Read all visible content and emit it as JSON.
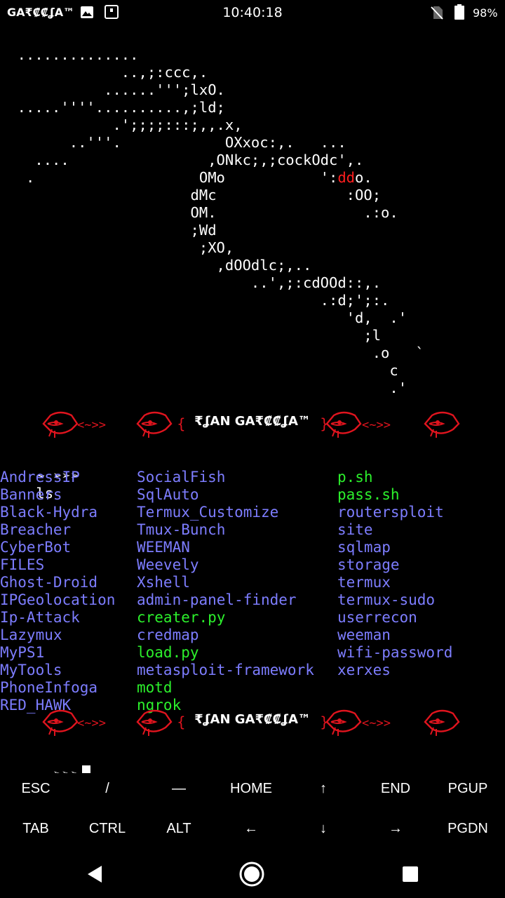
{
  "status_bar": {
    "carrier": "GA₹₡₡ʆA™",
    "time": "10:40:18",
    "battery": "98%",
    "icons": [
      "image-icon",
      "screenshot-icon",
      "no-sim-icon",
      "battery-icon"
    ]
  },
  "ascii_art": {
    "lines": [
      "  ..............",
      "              ..,;:ccc,.",
      "            ......''';lxO.",
      "  .....''''..........,;ld;",
      "             .';;;;:::;,,.x,",
      "        ..'''.            OXxoc:,.   ...",
      "    ....                ,ONkc;,;cockOdc',.",
      "   .                   OMo           ':",
      "                      dMc               :OO;",
      "                      OM.                 .:o.",
      "                      ;Wd",
      "                       ;XO,",
      "                         ,dOOdlc;,..",
      "                             ..',;:cdOOd::,.",
      "                                     .:d;';:.",
      "                                        'd,  .'",
      "                                          ;l",
      "                                           .o   `",
      "                                             c",
      "                                             .'"
    ],
    "line8_red": "dd",
    "line8_tail": "o."
  },
  "banner": {
    "text": "₹ʆAN GA₹₡₡ʆA™",
    "arrows": "<~>>",
    "fish_color": "#e0141e"
  },
  "prompt": {
    "symbol": "~ ➢➢➢",
    "command": "ls"
  },
  "listing": {
    "col1": [
      {
        "name": "AndressIP",
        "type": "dir"
      },
      {
        "name": "Banners",
        "type": "dir"
      },
      {
        "name": "Black-Hydra",
        "type": "dir"
      },
      {
        "name": "Breacher",
        "type": "dir"
      },
      {
        "name": "CyberBot",
        "type": "dir"
      },
      {
        "name": "FILES",
        "type": "dir"
      },
      {
        "name": "Ghost-Droid",
        "type": "dir"
      },
      {
        "name": "IPGeolocation",
        "type": "dir"
      },
      {
        "name": "Ip-Attack",
        "type": "dir"
      },
      {
        "name": "Lazymux",
        "type": "dir"
      },
      {
        "name": "MyPS1",
        "type": "dir"
      },
      {
        "name": "MyTools",
        "type": "dir"
      },
      {
        "name": "PhoneInfoga",
        "type": "dir"
      },
      {
        "name": "RED_HAWK",
        "type": "dir"
      }
    ],
    "col2": [
      {
        "name": "SocialFish",
        "type": "dir"
      },
      {
        "name": "SqlAuto",
        "type": "dir"
      },
      {
        "name": "Termux_Customize",
        "type": "dir"
      },
      {
        "name": "Tmux-Bunch",
        "type": "dir"
      },
      {
        "name": "WEEMAN",
        "type": "dir"
      },
      {
        "name": "Weevely",
        "type": "dir"
      },
      {
        "name": "Xshell",
        "type": "dir"
      },
      {
        "name": "admin-panel-finder",
        "type": "dir"
      },
      {
        "name": "creater.py",
        "type": "exe"
      },
      {
        "name": "credmap",
        "type": "dir"
      },
      {
        "name": "load.py",
        "type": "exe"
      },
      {
        "name": "metasploit-framework",
        "type": "dir"
      },
      {
        "name": "motd",
        "type": "exe"
      },
      {
        "name": "ngrok",
        "type": "exe"
      }
    ],
    "col3": [
      {
        "name": "p.sh",
        "type": "exe"
      },
      {
        "name": "pass.sh",
        "type": "exe"
      },
      {
        "name": "routersploit",
        "type": "dir"
      },
      {
        "name": "site",
        "type": "dir"
      },
      {
        "name": "sqlmap",
        "type": "dir"
      },
      {
        "name": "storage",
        "type": "dir"
      },
      {
        "name": "termux",
        "type": "dir"
      },
      {
        "name": "termux-sudo",
        "type": "dir"
      },
      {
        "name": "userrecon",
        "type": "dir"
      },
      {
        "name": "weeman",
        "type": "dir"
      },
      {
        "name": "wifi-password",
        "type": "dir"
      },
      {
        "name": "xerxes",
        "type": "dir"
      }
    ],
    "colors": {
      "dir": "#7d7dff",
      "exe": "#2cf02c"
    }
  },
  "extra_keys": {
    "row1": [
      "ESC",
      "/",
      "—",
      "HOME",
      "↑",
      "END",
      "PGUP"
    ],
    "row2": [
      "TAB",
      "CTRL",
      "ALT",
      "←",
      "↓",
      "→",
      "PGDN"
    ]
  },
  "nav_bar": {
    "icons": [
      "back-icon",
      "home-icon",
      "recents-icon"
    ]
  }
}
